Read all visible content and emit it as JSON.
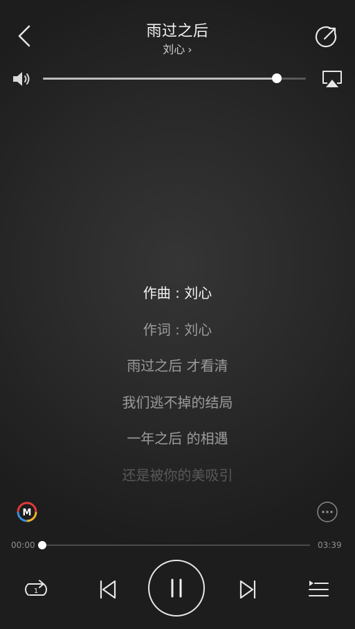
{
  "header": {
    "title": "雨过之后",
    "artist": "刘心",
    "artist_chevron": "›"
  },
  "volume": {
    "level": 0.89
  },
  "lyrics": {
    "lines": [
      "作曲 : 刘心",
      "作词 : 刘心",
      "雨过之后 才看清",
      "我们逃不掉的结局",
      "一年之后 的相遇",
      "还是被你的美吸引"
    ],
    "current_index": 0
  },
  "badges": {
    "quality": "M"
  },
  "playback": {
    "elapsed": "00:00",
    "total": "03:39",
    "progress": 0.0,
    "repeat_count": "1",
    "state": "playing"
  },
  "icons": {
    "back": "chevron-left-icon",
    "share": "share-icon",
    "volume": "speaker-icon",
    "airplay": "airplay-icon",
    "more": "more-icon",
    "repeat": "repeat-one-icon",
    "prev": "skip-previous-icon",
    "pause": "pause-icon",
    "next": "skip-next-icon",
    "queue": "playlist-icon"
  },
  "colors": {
    "background": "#2b2b2b",
    "text_primary": "#f4f4f4",
    "text_secondary": "#9c9c9c",
    "badge_red": "#e03a3a",
    "badge_blue": "#3a8fe0",
    "badge_yellow": "#f0b429"
  }
}
